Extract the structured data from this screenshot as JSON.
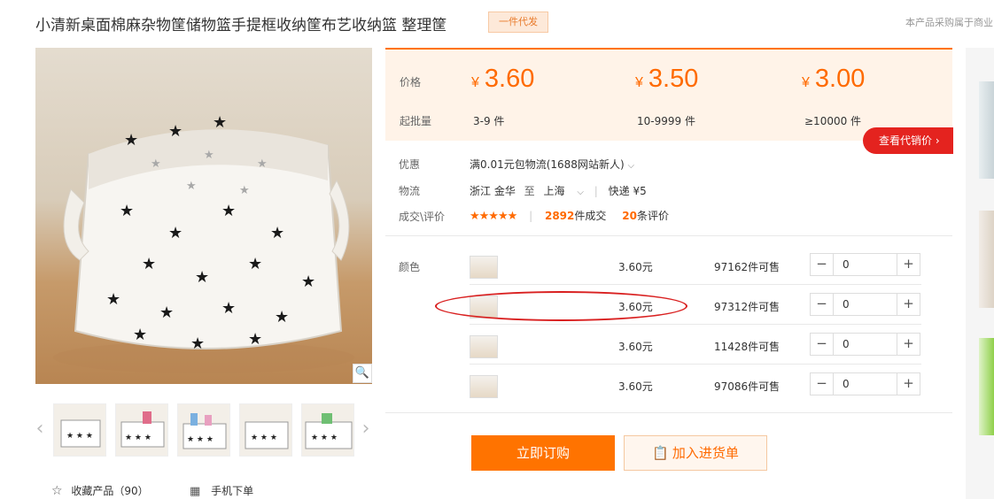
{
  "product": {
    "title": "小清新桌面棉麻杂物筐储物篮手提框收纳筐布艺收纳篮 整理筐",
    "badge": "一件代发",
    "notice": "本产品采购属于商业"
  },
  "gallery": {
    "zoom_icon": "magnifier-icon",
    "thumbnails_count": 5,
    "favorite_label": "收藏产品（90）",
    "mobile_label": "手机下单"
  },
  "pricing": {
    "price_label": "价格",
    "batch_label": "起批量",
    "currency": "¥",
    "tiers": [
      {
        "price": "3.60",
        "batch": "3-9 件"
      },
      {
        "price": "3.50",
        "batch": "10-9999 件"
      },
      {
        "price": "3.00",
        "batch": "≥10000 件"
      }
    ],
    "agent_price_button": "查看代销价 ›"
  },
  "info": {
    "promo_label": "优惠",
    "promo_value": "满0.01元包物流(1688网站新人)",
    "logistics_label": "物流",
    "from": "浙江 金华",
    "to_word": "至",
    "to": "上海",
    "express": "快递 ¥5",
    "deal_label": "成交\\评价",
    "stars": "★★★★★",
    "deals_count": "2892",
    "deals_word": "件成交",
    "reviews_count": "20",
    "reviews_word": "条评价"
  },
  "sku": {
    "color_label": "颜色",
    "rows": [
      {
        "price": "3.60元",
        "stock": "97162件可售",
        "qty": "0"
      },
      {
        "price": "3.60元",
        "stock": "97312件可售",
        "qty": "0"
      },
      {
        "price": "3.60元",
        "stock": "11428件可售",
        "qty": "0"
      },
      {
        "price": "3.60元",
        "stock": "97086件可售",
        "qty": "0"
      }
    ],
    "minus": "−",
    "plus": "+"
  },
  "actions": {
    "buy_now": "立即订购",
    "add_cart": "加入进货单"
  },
  "colors": {
    "accent": "#ff6a00",
    "red": "#e4231f"
  }
}
